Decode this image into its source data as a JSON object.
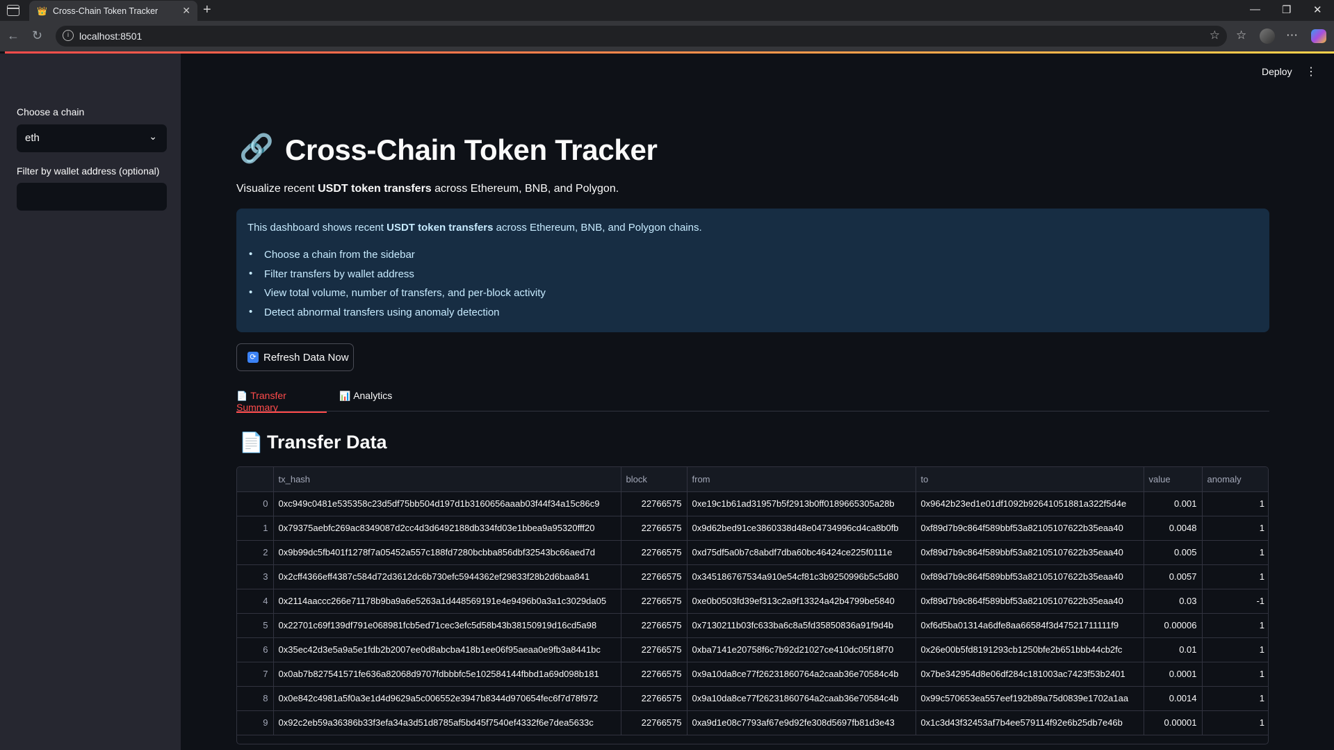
{
  "browser": {
    "tab_title": "Cross-Chain Token Tracker",
    "url": "localhost:8501"
  },
  "app": {
    "deploy_label": "Deploy"
  },
  "sidebar": {
    "chain_label": "Choose a chain",
    "chain_value": "eth",
    "wallet_label": "Filter by wallet address (optional)",
    "wallet_value": ""
  },
  "main": {
    "title_icon": "🔗",
    "title": "Cross-Chain Token Tracker",
    "subtitle_pre": "Visualize recent ",
    "subtitle_bold": "USDT token transfers",
    "subtitle_post": " across Ethereum, BNB, and Polygon.",
    "info_pre": "This dashboard shows recent ",
    "info_bold": "USDT token transfers",
    "info_post": " across Ethereum, BNB, and Polygon chains.",
    "info_items": [
      "Choose a chain from the sidebar",
      "Filter transfers by wallet address",
      "View total volume, number of transfers, and per-block activity",
      "Detect abnormal transfers using anomaly detection"
    ],
    "refresh_label": "Refresh Data Now",
    "tabs": [
      {
        "icon": "📄",
        "label": "Transfer Summary"
      },
      {
        "icon": "📊",
        "label": "Analytics"
      }
    ],
    "section_icon": "📄",
    "section_title": "Transfer Data"
  },
  "table": {
    "columns": [
      "",
      "tx_hash",
      "block",
      "from",
      "to",
      "value",
      "anomaly"
    ],
    "rows": [
      [
        "0",
        "0xc949c0481e535358c23d5df75bb504d197d1b3160656aaab03f44f34a15c86c9",
        "22766575",
        "0xe19c1b61ad31957b5f2913b0ff0189665305a28b",
        "0x9642b23ed1e01df1092b92641051881a322f5d4e",
        "0.001",
        "1"
      ],
      [
        "1",
        "0x79375aebfc269ac8349087d2cc4d3d6492188db334fd03e1bbea9a95320fff20",
        "22766575",
        "0x9d62bed91ce3860338d48e04734996cd4ca8b0fb",
        "0xf89d7b9c864f589bbf53a82105107622b35eaa40",
        "0.0048",
        "1"
      ],
      [
        "2",
        "0x9b99dc5fb401f1278f7a05452a557c188fd7280bcbba856dbf32543bc66aed7d",
        "22766575",
        "0xd75df5a0b7c8abdf7dba60bc46424ce225f0111e",
        "0xf89d7b9c864f589bbf53a82105107622b35eaa40",
        "0.005",
        "1"
      ],
      [
        "3",
        "0x2cff4366eff4387c584d72d3612dc6b730efc5944362ef29833f28b2d6baa841",
        "22766575",
        "0x345186767534a910e54cf81c3b9250996b5c5d80",
        "0xf89d7b9c864f589bbf53a82105107622b35eaa40",
        "0.0057",
        "1"
      ],
      [
        "4",
        "0x2114aaccc266e71178b9ba9a6e5263a1d448569191e4e9496b0a3a1c3029da05",
        "22766575",
        "0xe0b0503fd39ef313c2a9f13324a42b4799be5840",
        "0xf89d7b9c864f589bbf53a82105107622b35eaa40",
        "0.03",
        "-1"
      ],
      [
        "5",
        "0x22701c69f139df791e068981fcb5ed71cec3efc5d58b43b38150919d16cd5a98",
        "22766575",
        "0x7130211b03fc633ba6c8a5fd35850836a91f9d4b",
        "0xf6d5ba01314a6dfe8aa66584f3d47521711111f9",
        "0.00006",
        "1"
      ],
      [
        "6",
        "0x35ec42d3e5a9a5e1fdb2b2007ee0d8abcba418b1ee06f95aeaa0e9fb3a8441bc",
        "22766575",
        "0xba7141e20758f6c7b92d21027ce410dc05f18f70",
        "0x26e00b5fd8191293cb1250bfe2b651bbb44cb2fc",
        "0.01",
        "1"
      ],
      [
        "7",
        "0x0ab7b827541571fe636a82068d9707fdbbbfc5e102584144fbbd1a69d098b181",
        "22766575",
        "0x9a10da8ce77f26231860764a2caab36e70584c4b",
        "0x7be342954d8e06df284c181003ac7423f53b2401",
        "0.0001",
        "1"
      ],
      [
        "8",
        "0x0e842c4981a5f0a3e1d4d9629a5c006552e3947b8344d970654fec6f7d78f972",
        "22766575",
        "0x9a10da8ce77f26231860764a2caab36e70584c4b",
        "0x99c570653ea557eef192b89a75d0839e1702a1aa",
        "0.0014",
        "1"
      ],
      [
        "9",
        "0x92c2eb59a36386b33f3efa34a3d51d8785af5bd45f7540ef4332f6e7dea5633c",
        "22766575",
        "0xa9d1e08c7793af67e9d92fe308d5697fb81d3e43",
        "0x1c3d43f32453af7b4ee579114f92e6b25db7e46b",
        "0.00001",
        "1"
      ]
    ]
  }
}
